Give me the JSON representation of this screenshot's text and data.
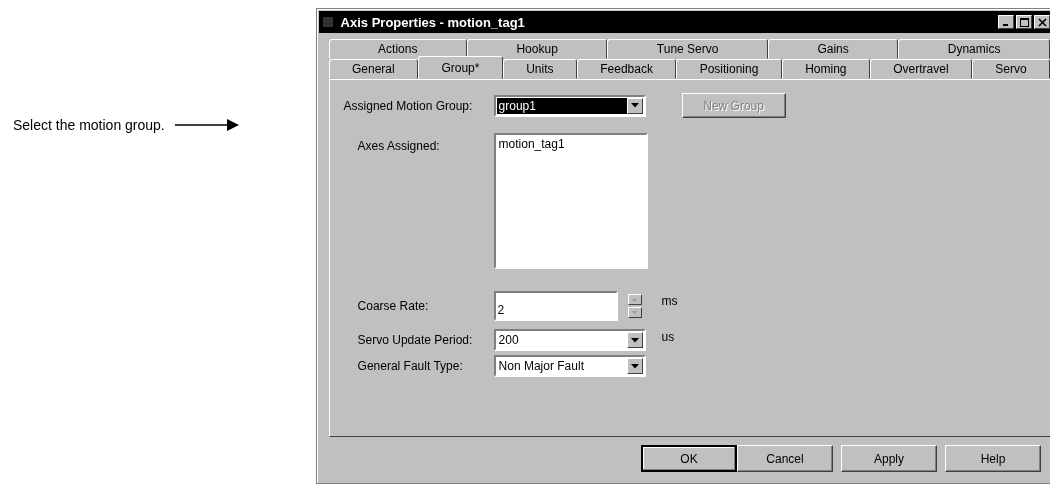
{
  "annotation": {
    "text": "Select the motion group."
  },
  "window": {
    "title": "Axis Properties - motion_tag1"
  },
  "tab_rows": [
    [
      {
        "label": "Actions",
        "selected": false
      },
      {
        "label": "Hookup",
        "selected": false
      },
      {
        "label": "Tune Servo",
        "selected": false
      },
      {
        "label": "Gains",
        "selected": false
      },
      {
        "label": "Dynamics",
        "selected": false
      }
    ],
    [
      {
        "label": "General",
        "selected": false
      },
      {
        "label": "Group*",
        "selected": true
      },
      {
        "label": "Units",
        "selected": false
      },
      {
        "label": "Feedback",
        "selected": false
      },
      {
        "label": "Positioning",
        "selected": false
      },
      {
        "label": "Homing",
        "selected": false
      },
      {
        "label": "Overtravel",
        "selected": false
      },
      {
        "label": "Servo",
        "selected": false
      }
    ]
  ],
  "assigned_motion_group": {
    "label": "Assigned Motion Group:",
    "value": "group1",
    "focused": true
  },
  "new_group_button": {
    "label": "New Group",
    "disabled": true
  },
  "axes_assigned": {
    "label": "Axes Assigned:",
    "items": [
      "motion_tag1"
    ]
  },
  "coarse_rate": {
    "label": "Coarse Rate:",
    "value": "2",
    "unit": "ms"
  },
  "servo_update_period": {
    "label": "Servo Update Period:",
    "value": "200",
    "unit": "us"
  },
  "general_fault_type": {
    "label": "General Fault Type:",
    "value": "Non Major Fault"
  },
  "buttons": [
    {
      "label": "OK",
      "default": true
    },
    {
      "label": "Cancel",
      "default": false
    },
    {
      "label": "Apply",
      "default": false
    },
    {
      "label": "Help",
      "default": false
    }
  ]
}
